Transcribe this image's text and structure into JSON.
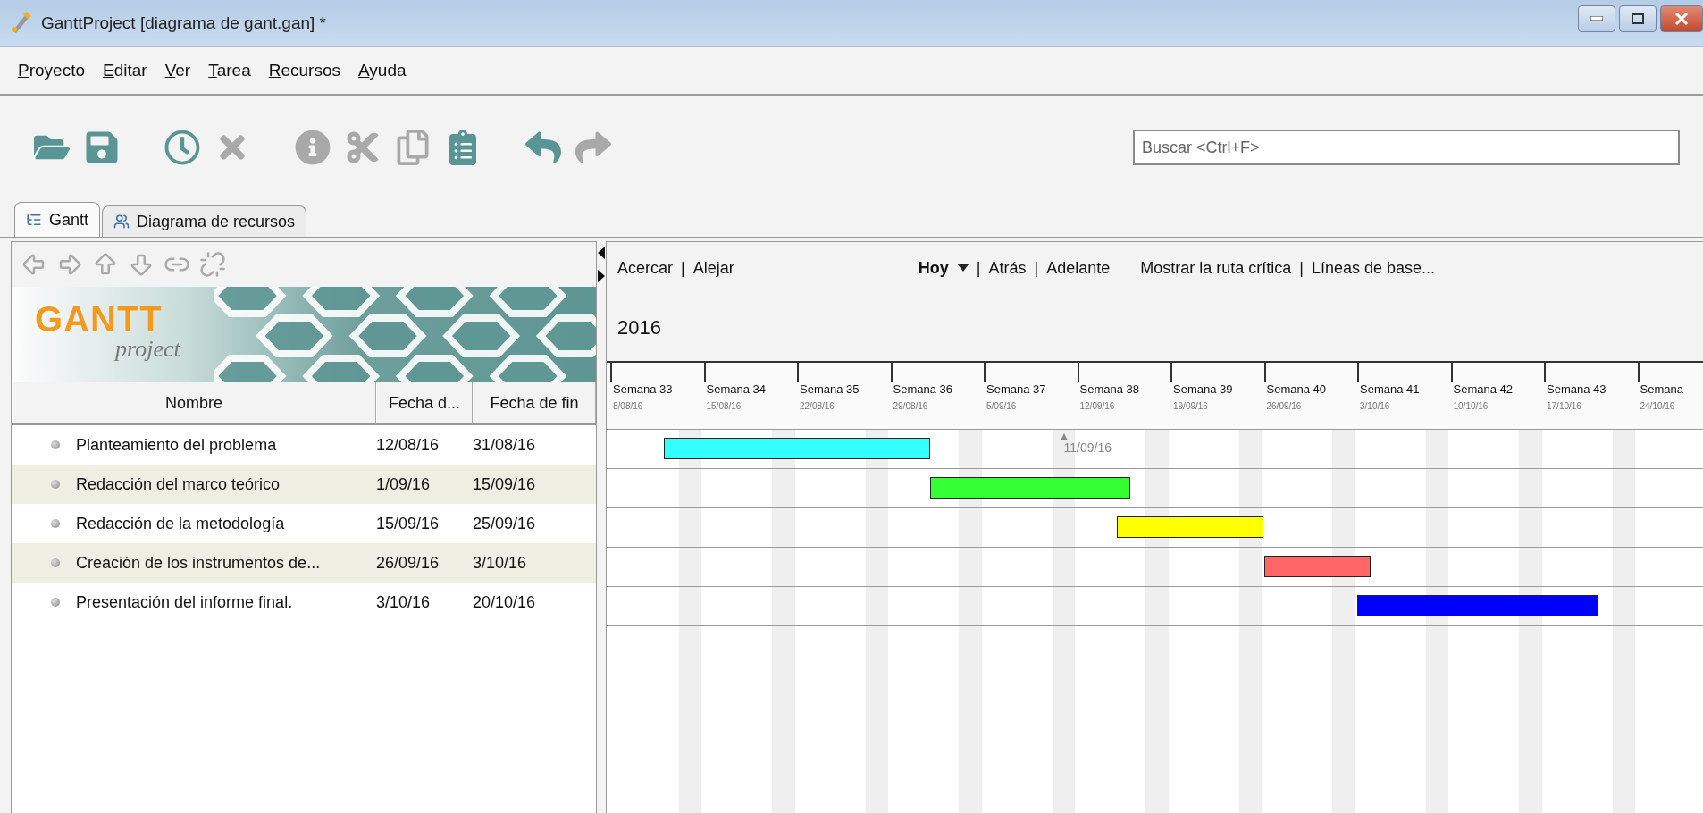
{
  "window": {
    "title": "GanttProject [diagrama de gant.gan] *"
  },
  "menu": [
    "Proyecto",
    "Editar",
    "Ver",
    "Tarea",
    "Recursos",
    "Ayuda"
  ],
  "toolbar": [
    {
      "kind": "open",
      "disabled": false
    },
    {
      "kind": "save",
      "disabled": false
    },
    {
      "kind": "clock",
      "disabled": false
    },
    {
      "kind": "delete",
      "disabled": true
    },
    {
      "kind": "info",
      "disabled": true
    },
    {
      "kind": "cut",
      "disabled": true
    },
    {
      "kind": "copy",
      "disabled": true
    },
    {
      "kind": "paste",
      "disabled": false
    },
    {
      "kind": "undo",
      "disabled": false
    },
    {
      "kind": "redo",
      "disabled": true
    }
  ],
  "search": {
    "placeholder": "Buscar <Ctrl+F>"
  },
  "tabs": [
    {
      "label": "Gantt",
      "kind": "tasks",
      "selected": true
    },
    {
      "label": "Diagrama de recursos",
      "kind": "resources",
      "selected": false
    }
  ],
  "task_tools": [
    {
      "kind": "left",
      "disabled": true
    },
    {
      "kind": "right",
      "disabled": true
    },
    {
      "kind": "up",
      "disabled": true
    },
    {
      "kind": "down",
      "disabled": true
    },
    {
      "kind": "link",
      "disabled": true
    },
    {
      "kind": "unlink",
      "disabled": true
    }
  ],
  "logo": {
    "title": "GANTT",
    "subtitle": "project"
  },
  "table": {
    "columns": [
      "Nombre",
      "Fecha d...",
      "Fecha de fin"
    ],
    "rows": [
      {
        "name": "Planteamiento del problema",
        "start": "12/08/16",
        "end": "31/08/16",
        "color": "#33ffff"
      },
      {
        "name": "Redacción del marco teórico",
        "start": "1/09/16",
        "end": "15/09/16",
        "color": "#33ff33"
      },
      {
        "name": "Redacción de la metodología",
        "start": "15/09/16",
        "end": "25/09/16",
        "color": "#ffff00"
      },
      {
        "name": "Creación de los instrumentos de...",
        "start": "26/09/16",
        "end": "3/10/16",
        "color": "#ff6666"
      },
      {
        "name": "Presentación del informe final.",
        "start": "3/10/16",
        "end": "20/10/16",
        "color": "#0000ff"
      }
    ]
  },
  "chart_toolbar": {
    "separator": "|",
    "zoom": [
      "Acercar",
      "Alejar"
    ],
    "today": "Hoy",
    "navigation": [
      "Atrás",
      "Adelante"
    ],
    "options": [
      "Mostrar la ruta crítica",
      "Líneas de base..."
    ]
  },
  "timeline": {
    "year": "2016",
    "today": "11/09/16",
    "weeks": [
      {
        "label": "Semana 33",
        "date": "8/08/16"
      },
      {
        "label": "Semana 34",
        "date": "15/08/16"
      },
      {
        "label": "Semana 35",
        "date": "22/08/16"
      },
      {
        "label": "Semana 36",
        "date": "29/08/16"
      },
      {
        "label": "Semana 37",
        "date": "5/09/16"
      },
      {
        "label": "Semana 38",
        "date": "12/09/16"
      },
      {
        "label": "Semana 39",
        "date": "19/09/16"
      },
      {
        "label": "Semana 40",
        "date": "26/09/16"
      },
      {
        "label": "Semana 41",
        "date": "3/10/16"
      },
      {
        "label": "Semana 42",
        "date": "10/10/16"
      },
      {
        "label": "Semana 43",
        "date": "17/10/16"
      },
      {
        "label": "Semana",
        "date": "24/10/16"
      }
    ]
  }
}
